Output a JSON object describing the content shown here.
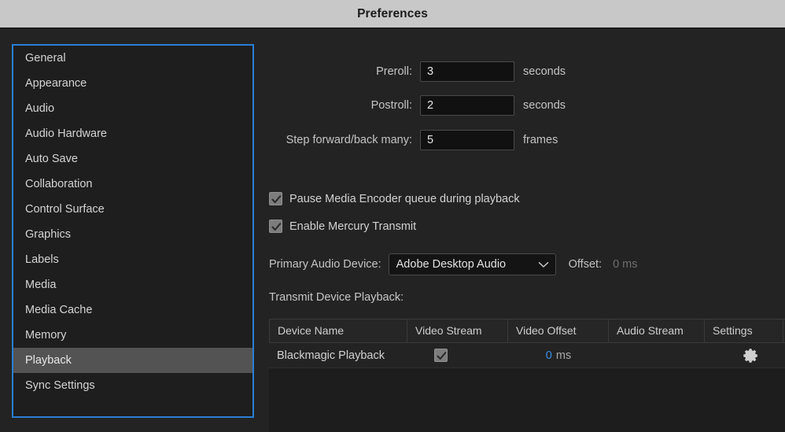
{
  "window": {
    "title": "Preferences"
  },
  "sidebar": {
    "items": [
      {
        "label": "General",
        "selected": false
      },
      {
        "label": "Appearance",
        "selected": false
      },
      {
        "label": "Audio",
        "selected": false
      },
      {
        "label": "Audio Hardware",
        "selected": false
      },
      {
        "label": "Auto Save",
        "selected": false
      },
      {
        "label": "Collaboration",
        "selected": false
      },
      {
        "label": "Control Surface",
        "selected": false
      },
      {
        "label": "Graphics",
        "selected": false
      },
      {
        "label": "Labels",
        "selected": false
      },
      {
        "label": "Media",
        "selected": false
      },
      {
        "label": "Media Cache",
        "selected": false
      },
      {
        "label": "Memory",
        "selected": false
      },
      {
        "label": "Playback",
        "selected": true
      },
      {
        "label": "Sync Settings",
        "selected": false
      }
    ]
  },
  "playback": {
    "preroll": {
      "label": "Preroll:",
      "value": "3",
      "unit": "seconds"
    },
    "postroll": {
      "label": "Postroll:",
      "value": "2",
      "unit": "seconds"
    },
    "step": {
      "label": "Step forward/back many:",
      "value": "5",
      "unit": "frames"
    },
    "pause_encoder": {
      "label": "Pause Media Encoder queue during playback",
      "checked": true
    },
    "mercury_transmit": {
      "label": "Enable Mercury Transmit",
      "checked": true
    },
    "primary_audio_device": {
      "label": "Primary Audio Device:",
      "value": "Adobe Desktop Audio",
      "chevron_icon": "chevron-down-icon"
    },
    "offset": {
      "label": "Offset:",
      "value": "0 ms"
    },
    "transmit_section_label": "Transmit Device Playback:",
    "table": {
      "columns": [
        "Device Name",
        "Video Stream",
        "Video Offset",
        "Audio Stream",
        "Settings"
      ],
      "rows": [
        {
          "device_name": "Blackmagic Playback",
          "video_stream_checked": true,
          "video_offset_number": "0",
          "video_offset_unit": "ms",
          "audio_stream_checked": false,
          "settings_icon": "gear-icon"
        }
      ]
    }
  },
  "colors": {
    "accent_blue": "#2a7fd4",
    "value_blue": "#3a8fe0",
    "panel_bg": "#232323",
    "sidebar_bg": "#1e1e1e",
    "selection_gray": "#535353",
    "titlebar_bg": "#c8c8c8"
  }
}
